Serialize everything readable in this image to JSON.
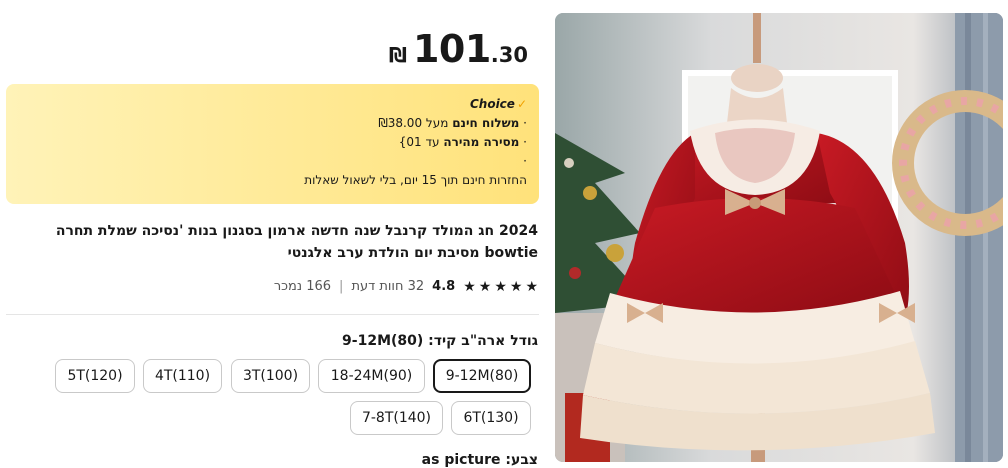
{
  "price": {
    "currency": "₪",
    "integer": "101",
    "decimal": ".30"
  },
  "choice": {
    "badge": "Choice",
    "line1_prefix": "מעל ₪38.00",
    "line1_bold": "משלוח חינם",
    "line2_bold": "מסירה מהירה",
    "line2_rest": "עד 01}",
    "line3": "",
    "line4": "החזרות חינם תוך 15 יום, בלי לשאול שאלות"
  },
  "product": {
    "title": "2024 חג המולד קרנבל שנה חדשה ארמון בסגנון בנות 'נסיכה שמלת תחרה bowtie מסיבת יום הולדת ערב אלגנטי",
    "rating": "4.8",
    "reviews": "32 חוות דעת",
    "sold": "166 נמכר"
  },
  "sizes": {
    "label": "גודל ארה\"ב קיד: ",
    "selected_value": "9-12M(80)",
    "options": [
      "9-12M(80)",
      "18-24M(90)",
      "3T(100)",
      "4T(110)",
      "5T(120)",
      "6T(130)",
      "7-8T(140)"
    ]
  },
  "color": {
    "label": "צבע: ",
    "value": "as picture"
  },
  "colors": {
    "choice_gradient_start": "#fff3b8",
    "choice_gradient_end": "#ffe27a",
    "accent_check": "#f2a100",
    "text": "#191919",
    "dress_red": "#b5121b"
  }
}
